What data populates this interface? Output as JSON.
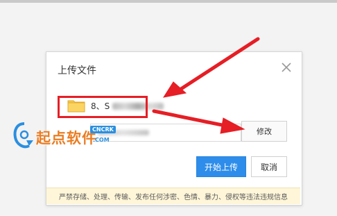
{
  "dialog": {
    "title": "上传文件",
    "close_icon": "close-icon"
  },
  "file": {
    "name_prefix": "8、S",
    "icon": "folder-icon"
  },
  "path_field": {
    "modify_label": "修改"
  },
  "actions": {
    "start_label": "开始上传",
    "cancel_label": "取消"
  },
  "notice": {
    "text": "严禁存储、处理、传输、发布任何涉密、色情、暴力、侵权等违法违规信息"
  },
  "watermark": {
    "logo_text": "起点软件",
    "badge": "CNCRK",
    "domain": ".COM"
  },
  "colors": {
    "primary": "#2e8dea",
    "annotation_red": "#e61e25",
    "notice_bg": "#fff6d9",
    "folder_yellow": "#f7c948"
  }
}
